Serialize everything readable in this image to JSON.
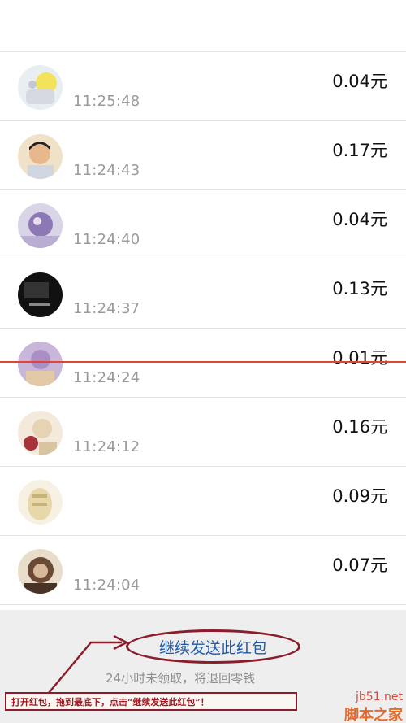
{
  "records": [
    {
      "time": "11:25:48",
      "amount": "0.04元"
    },
    {
      "time": "11:24:43",
      "amount": "0.17元"
    },
    {
      "time": "11:24:40",
      "amount": "0.04元"
    },
    {
      "time": "11:24:37",
      "amount": "0.13元"
    },
    {
      "time": "11:24:24",
      "amount": "0.01元"
    },
    {
      "time": "11:24:12",
      "amount": "0.16元"
    },
    {
      "time": "",
      "amount": "0.09元"
    },
    {
      "time": "11:24:04",
      "amount": "0.07元"
    }
  ],
  "footer": {
    "resend_label": "继续发送此红包",
    "notice": "24小时未领取，将退回零钱",
    "instruction": "打开红包，拖到最底下，点击“继续发送此红包”！"
  },
  "watermark": {
    "site": "jb51.net",
    "name": "脚本之家"
  },
  "colors": {
    "annotation": "#8b1d2a",
    "link": "#1f5aa7",
    "red_line": "#e0443a"
  },
  "icons": [
    "avatar-icon"
  ]
}
